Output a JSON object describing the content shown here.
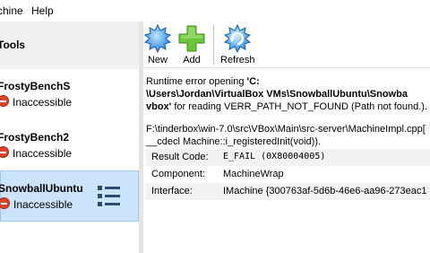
{
  "menu": {
    "items": [
      {
        "label": "chine"
      },
      {
        "label": "Help"
      }
    ]
  },
  "sidebar": {
    "tools_label": "Tools",
    "vms": [
      {
        "name": "FrostyBenchS",
        "status": "Inaccessible"
      },
      {
        "name": "FrostyBench2",
        "status": "Inaccessible"
      },
      {
        "name": "SnowballUbuntu",
        "status": "Inaccessible"
      }
    ]
  },
  "toolbar": {
    "new_label": "New",
    "add_label": "Add",
    "refresh_label": "Refresh"
  },
  "error": {
    "line1_prefix": "Runtime error opening ",
    "path": "'C:\\Users\\Jordan\\VirtualBox VMs\\SnowballUbuntu\\SnowballUbuntu.vbox'",
    "path_line1": "'C:",
    "path_line2": "\\Users\\Jordan\\VirtualBox VMs\\SnowballUbuntu\\Snowba",
    "path_line3": "vbox'",
    "line3_suffix": " for reading VERR_PATH_NOT_FOUND (Path not found.).",
    "location_line1": "F:\\tinderbox\\win-7.0\\src\\VBox\\Main\\src-server\\MachineImpl.cpp[",
    "location_line2": "__cdecl Machine::i_registeredInit(void)).",
    "details": [
      {
        "key": "Result Code:",
        "value": "E_FAIL (0X80004005)"
      },
      {
        "key": "Component:",
        "value": "MachineWrap"
      },
      {
        "key": "Interface:",
        "value": "IMachine {300763af-5d6b-46e6-aa96-273eac1"
      }
    ]
  },
  "colors": {
    "selection": "#cce4fb",
    "error_icon": "#d9442b",
    "new_icon": "#2e86de",
    "add_icon": "#5cb82d",
    "refresh_icon": "#2f8fd8"
  }
}
